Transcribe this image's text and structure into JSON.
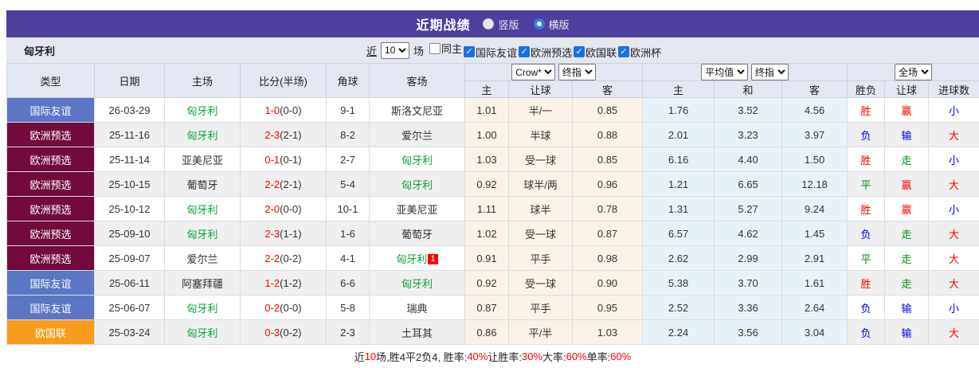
{
  "title_bar": {
    "title": "近期战绩",
    "radios": [
      {
        "label": "竖版",
        "checked": false
      },
      {
        "label": "横版",
        "checked": true
      }
    ]
  },
  "filter_bar": {
    "team": "匈牙利",
    "near_label": "近",
    "matches_value": "10",
    "matches_suffix": "场",
    "checkboxes": [
      {
        "label": "同主",
        "checked": false
      },
      {
        "label": "国际友谊",
        "checked": true
      },
      {
        "label": "欧洲预选",
        "checked": true
      },
      {
        "label": "欧国联",
        "checked": true
      },
      {
        "label": "欧洲杯",
        "checked": true
      }
    ]
  },
  "table": {
    "headers": {
      "left": [
        "类型",
        "日期",
        "主场",
        "比分(半场)",
        "角球",
        "客场"
      ],
      "selects": {
        "odds_company": "Crow*",
        "odds_time": "终指",
        "avg_source": "平均值",
        "avg_time": "终指",
        "scope": "全场"
      },
      "sub": [
        "主",
        "让球",
        "客",
        "主",
        "和",
        "客",
        "胜负",
        "让球",
        "进球数"
      ]
    },
    "type_colors": {
      "国际友谊": "#5B76C4",
      "欧洲预选": "#720A3C",
      "欧国联": "#F89B1C"
    },
    "rows": [
      {
        "type": "国际友谊",
        "date": "26-03-29",
        "home": "匈牙利",
        "home_green": true,
        "score": "1-0",
        "half": "(0-0)",
        "corners": "9-1",
        "away": "斯洛文尼亚",
        "away_green": false,
        "hdp_home": "1.01",
        "hdp_line": "半/一",
        "hdp_away": "0.85",
        "avg_home": "1.76",
        "avg_draw": "3.52",
        "avg_away": "4.56",
        "res_wdl": {
          "t": "胜",
          "c": "red"
        },
        "res_hdp": {
          "t": "赢",
          "c": "red"
        },
        "res_ou": {
          "t": "小",
          "c": "blue"
        }
      },
      {
        "type": "欧洲预选",
        "date": "25-11-16",
        "home": "匈牙利",
        "home_green": true,
        "score": "2-3",
        "half": "(2-1)",
        "corners": "8-2",
        "away": "爱尔兰",
        "away_green": false,
        "hdp_home": "1.00",
        "hdp_line": "半球",
        "hdp_away": "0.88",
        "avg_home": "2.01",
        "avg_draw": "3.23",
        "avg_away": "3.97",
        "res_wdl": {
          "t": "负",
          "c": "blue"
        },
        "res_hdp": {
          "t": "输",
          "c": "blue"
        },
        "res_ou": {
          "t": "大",
          "c": "red"
        }
      },
      {
        "type": "欧洲预选",
        "date": "25-11-14",
        "home": "亚美尼亚",
        "home_green": false,
        "score": "0-1",
        "half": "(0-1)",
        "corners": "2-7",
        "away": "匈牙利",
        "away_green": true,
        "hdp_home": "1.03",
        "hdp_line": "受一球",
        "hdp_away": "0.85",
        "avg_home": "6.16",
        "avg_draw": "4.40",
        "avg_away": "1.50",
        "res_wdl": {
          "t": "胜",
          "c": "red"
        },
        "res_hdp": {
          "t": "走",
          "c": "green"
        },
        "res_ou": {
          "t": "小",
          "c": "blue"
        }
      },
      {
        "type": "欧洲预选",
        "date": "25-10-15",
        "home": "葡萄牙",
        "home_green": false,
        "score": "2-2",
        "half": "(2-1)",
        "corners": "5-4",
        "away": "匈牙利",
        "away_green": true,
        "hdp_home": "0.92",
        "hdp_line": "球半/两",
        "hdp_away": "0.96",
        "avg_home": "1.21",
        "avg_draw": "6.65",
        "avg_away": "12.18",
        "res_wdl": {
          "t": "平",
          "c": "green"
        },
        "res_hdp": {
          "t": "赢",
          "c": "red"
        },
        "res_ou": {
          "t": "大",
          "c": "red"
        }
      },
      {
        "type": "欧洲预选",
        "date": "25-10-12",
        "home": "匈牙利",
        "home_green": true,
        "score": "2-0",
        "half": "(0-0)",
        "corners": "10-1",
        "away": "亚美尼亚",
        "away_green": false,
        "hdp_home": "1.11",
        "hdp_line": "球半",
        "hdp_away": "0.78",
        "avg_home": "1.31",
        "avg_draw": "5.27",
        "avg_away": "9.24",
        "res_wdl": {
          "t": "胜",
          "c": "red"
        },
        "res_hdp": {
          "t": "赢",
          "c": "red"
        },
        "res_ou": {
          "t": "小",
          "c": "blue"
        }
      },
      {
        "type": "欧洲预选",
        "date": "25-09-10",
        "home": "匈牙利",
        "home_green": true,
        "score": "2-3",
        "half": "(1-1)",
        "corners": "1-6",
        "away": "葡萄牙",
        "away_green": false,
        "hdp_home": "1.02",
        "hdp_line": "受一球",
        "hdp_away": "0.87",
        "avg_home": "6.57",
        "avg_draw": "4.62",
        "avg_away": "1.45",
        "res_wdl": {
          "t": "负",
          "c": "blue"
        },
        "res_hdp": {
          "t": "走",
          "c": "green"
        },
        "res_ou": {
          "t": "大",
          "c": "red"
        }
      },
      {
        "type": "欧洲预选",
        "date": "25-09-07",
        "home": "爱尔兰",
        "home_green": false,
        "score": "2-2",
        "half": "(0-2)",
        "corners": "4-1",
        "away": "匈牙利",
        "away_green": true,
        "away_badge": "1",
        "hdp_home": "0.91",
        "hdp_line": "平手",
        "hdp_away": "0.98",
        "avg_home": "2.62",
        "avg_draw": "2.99",
        "avg_away": "2.91",
        "res_wdl": {
          "t": "平",
          "c": "green"
        },
        "res_hdp": {
          "t": "走",
          "c": "green"
        },
        "res_ou": {
          "t": "大",
          "c": "red"
        }
      },
      {
        "type": "国际友谊",
        "date": "25-06-11",
        "home": "阿塞拜疆",
        "home_green": false,
        "score": "1-2",
        "half": "(1-2)",
        "corners": "6-6",
        "away": "匈牙利",
        "away_green": true,
        "hdp_home": "0.92",
        "hdp_line": "受一球",
        "hdp_away": "0.90",
        "avg_home": "5.38",
        "avg_draw": "3.70",
        "avg_away": "1.61",
        "res_wdl": {
          "t": "胜",
          "c": "red"
        },
        "res_hdp": {
          "t": "走",
          "c": "green"
        },
        "res_ou": {
          "t": "大",
          "c": "red"
        }
      },
      {
        "type": "国际友谊",
        "date": "25-06-07",
        "home": "匈牙利",
        "home_green": true,
        "score": "0-2",
        "half": "(0-0)",
        "corners": "5-8",
        "away": "瑞典",
        "away_green": false,
        "hdp_home": "0.87",
        "hdp_line": "平手",
        "hdp_away": "0.95",
        "avg_home": "2.52",
        "avg_draw": "3.36",
        "avg_away": "2.64",
        "res_wdl": {
          "t": "负",
          "c": "blue"
        },
        "res_hdp": {
          "t": "输",
          "c": "blue"
        },
        "res_ou": {
          "t": "小",
          "c": "blue"
        }
      },
      {
        "type": "欧国联",
        "date": "25-03-24",
        "home": "匈牙利",
        "home_green": true,
        "score": "0-3",
        "half": "(0-2)",
        "corners": "2-3",
        "away": "土耳其",
        "away_green": false,
        "hdp_home": "0.86",
        "hdp_line": "平/半",
        "hdp_away": "1.03",
        "avg_home": "2.24",
        "avg_draw": "3.56",
        "avg_away": "3.04",
        "res_wdl": {
          "t": "负",
          "c": "blue"
        },
        "res_hdp": {
          "t": "输",
          "c": "blue"
        },
        "res_ou": {
          "t": "大",
          "c": "red"
        }
      }
    ]
  },
  "summary": {
    "segments": [
      {
        "t": "近",
        "red": false
      },
      {
        "t": "10",
        "red": true
      },
      {
        "t": "场,胜4平2负4, 胜率:",
        "red": false
      },
      {
        "t": "40%",
        "red": true
      },
      {
        "t": " 让胜率:",
        "red": false
      },
      {
        "t": "30%",
        "red": true
      },
      {
        "t": " 大率:",
        "red": false
      },
      {
        "t": "60%",
        "red": true
      },
      {
        "t": " 单率:",
        "red": false
      },
      {
        "t": "60%",
        "red": true
      }
    ]
  }
}
